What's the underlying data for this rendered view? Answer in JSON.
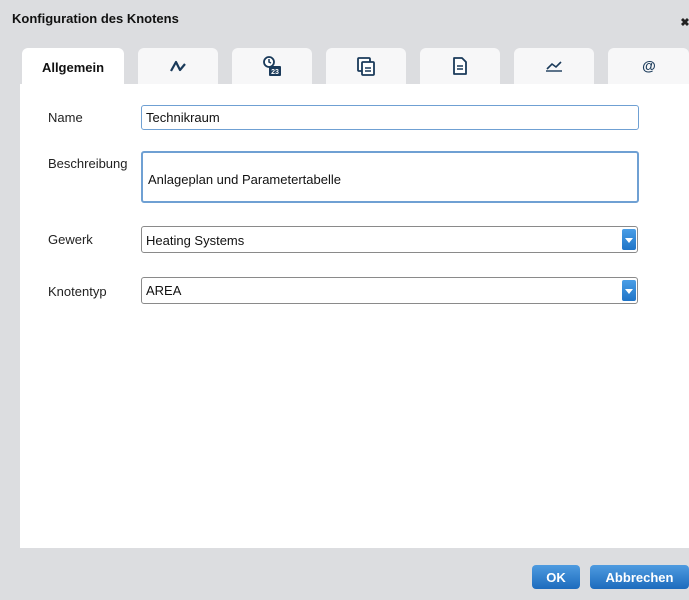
{
  "dialog": {
    "title": "Konfiguration des Knotens",
    "close_icon": "close-icon"
  },
  "tabs": [
    {
      "label": "Allgemein",
      "active": true
    },
    {
      "icon": "curve-icon"
    },
    {
      "icon": "calendar-clock-icon"
    },
    {
      "icon": "sheets-icon"
    },
    {
      "icon": "document-icon"
    },
    {
      "icon": "line-chart-icon"
    },
    {
      "icon": "at-icon"
    }
  ],
  "form": {
    "name_label": "Name",
    "name_value": "Technikraum",
    "description_label": "Beschreibung",
    "description_value": "Anlageplan und Parametertabelle",
    "trade_label": "Gewerk",
    "trade_value": "Heating Systems",
    "nodetype_label": "Knotentyp",
    "nodetype_value": "AREA"
  },
  "footer": {
    "ok_label": "OK",
    "cancel_label": "Abbrechen"
  },
  "colors": {
    "accent": "#2a7fd1",
    "background": "#dcdde0",
    "panel": "#ffffff"
  }
}
